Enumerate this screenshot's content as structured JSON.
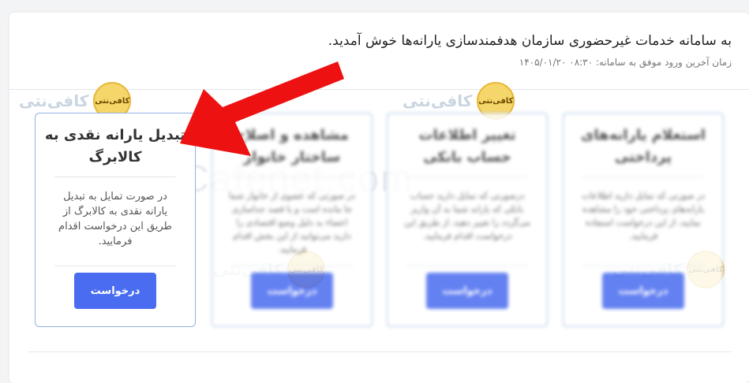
{
  "header": {
    "welcome": "به سامانه خدمات غیرحضوری سازمان هدفمندسازی یارانه‌ها خوش آمدید.",
    "last_login": "زمان آخرین ورود موفق به سامانه: ۰۸:۳۰ ۱۴۰۵/۰۱/۲۰"
  },
  "watermark": {
    "text": "Cafenet.com",
    "logo_text": "کافی‌نتی",
    "badge_text": "کافی‌نتی"
  },
  "cards": [
    {
      "title": "تبدیل یارانه نقدی به کالابرگ",
      "description": "در صورت تمایل به تبدیل یارانه نقدی به کالابرگ از طریق این درخواست اقدام فرمایید.",
      "button": "درخواست"
    },
    {
      "title": "مشاهده و اصلاح ساختار خانوار",
      "description": "در صورتی که عضوی از خانوار شما جا مانده است و یا قصد جداسازی اعضاء به دلیل وضع اقتصادی را دارید می‌توانید از این بخش اقدام فرمایید.",
      "button": "درخواست"
    },
    {
      "title": "تغییر اطلاعات حساب بانکی",
      "description": "درصورتی که تمایل دارید حساب بانکی که یارانه شما به آن واریز می‌گردد را تغییر دهید، از طریق این درخواست اقدام فرمایید.",
      "button": "درخواست"
    },
    {
      "title": "استعلام یارانه‌های پرداختی",
      "description": "در صورتی که تمایل دارید اطلاعات یارانه‌های پرداختی خود را مشاهده نمایید، از این درخواست استفاده فرمایید.",
      "button": "درخواست"
    }
  ],
  "colors": {
    "accent": "#4a6cf0",
    "arrow": "#ee1111",
    "card_border": "#8fb3e3"
  }
}
